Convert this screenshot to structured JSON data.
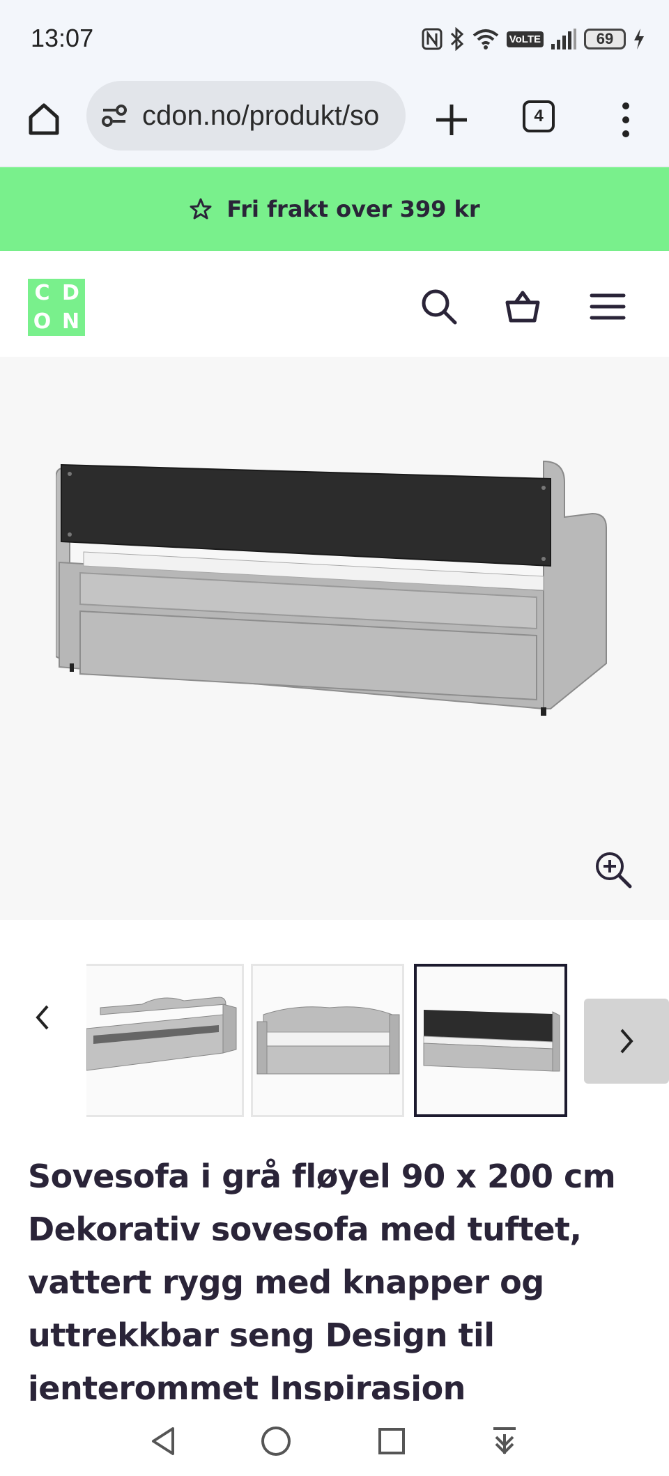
{
  "status_bar": {
    "time": "13:07",
    "battery": "69",
    "network_badge": "VoLTE",
    "icons": [
      "nfc-icon",
      "bluetooth-icon",
      "wifi-icon",
      "volte-icon",
      "signal-icon",
      "battery-icon",
      "charging-icon"
    ]
  },
  "browser": {
    "url": "cdon.no/produkt/so",
    "tab_count": "4",
    "icons": [
      "home-icon",
      "site-settings-icon",
      "plus-icon",
      "tab-switcher-icon",
      "more-vertical-icon"
    ]
  },
  "promo": {
    "text": "Fri frakt over 399 kr",
    "icon": "star-icon",
    "background": "#79f08c"
  },
  "header": {
    "logo_letters": [
      "C",
      "D",
      "O",
      "N"
    ],
    "icons": [
      "search-icon",
      "basket-icon",
      "menu-icon"
    ],
    "brand_color": "#79f08c"
  },
  "gallery": {
    "main_image": "sofa-bed-back-view",
    "zoom_icon": "zoom-in-icon",
    "thumbnails": [
      {
        "image": "sofa-frame-slats",
        "selected": false
      },
      {
        "image": "sofa-with-mattress",
        "selected": false
      },
      {
        "image": "sofa-back-view",
        "selected": true
      }
    ],
    "prev_icon": "chevron-left-icon",
    "next_icon": "chevron-right-icon"
  },
  "product": {
    "title": "Sovesofa i grå fløyel 90 x 200 cm Dekorativ sovesofa med tuftet, vat­tert rygg med knapper og uttrekk­bar seng Design til jenterommet Inspirasjon"
  },
  "nav_bar": {
    "icons": [
      "back-triangle-icon",
      "home-circle-icon",
      "recents-square-icon",
      "download-arrow-icon"
    ]
  }
}
